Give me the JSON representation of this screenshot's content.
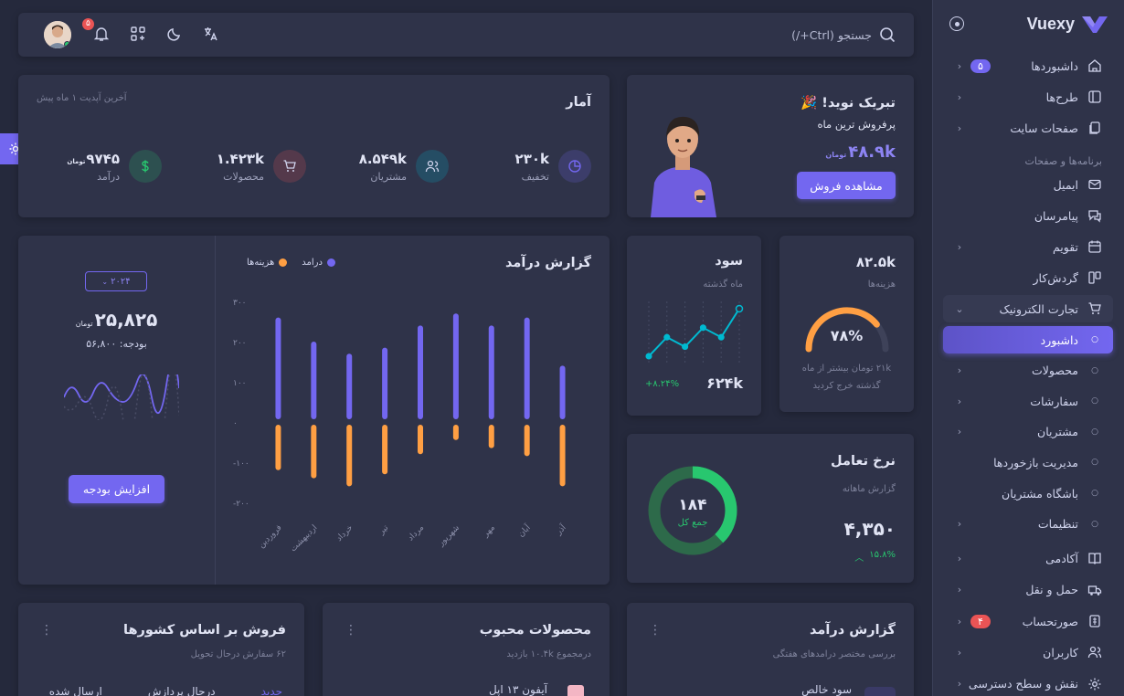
{
  "sidebar": {
    "brand": "Vuexy",
    "brand_color": "#7367f0",
    "items": [
      {
        "label": "داشبوردها",
        "icon": "home-icon",
        "badge": "۵",
        "badge_color": "#7367f0",
        "chev": true
      },
      {
        "label": "طرح‌ها",
        "icon": "layout-icon",
        "chev": true
      },
      {
        "label": "صفحات سایت",
        "icon": "files-icon",
        "chev": true
      }
    ],
    "section_apps": "برنامه‌ها و صفحات",
    "apps": [
      {
        "label": "ایمیل",
        "icon": "mail-icon"
      },
      {
        "label": "پیامرسان",
        "icon": "message-icon"
      },
      {
        "label": "تقویم",
        "icon": "calendar-icon",
        "chev": true
      },
      {
        "label": "گردش‌کار",
        "icon": "kanban-icon"
      },
      {
        "label": "تجارت الکترونیک",
        "icon": "cart-icon",
        "open": true
      }
    ],
    "ecom_sub": [
      {
        "label": "داشبورد",
        "active": true
      },
      {
        "label": "محصولات",
        "chev": true
      },
      {
        "label": "سفارشات",
        "chev": true
      },
      {
        "label": "مشتریان",
        "chev": true
      },
      {
        "label": "مدیریت بازخوردها"
      },
      {
        "label": "باشگاه مشتریان"
      },
      {
        "label": "تنظیمات",
        "chev": true
      }
    ],
    "more": [
      {
        "label": "آکادمی",
        "icon": "book-icon",
        "chev": true
      },
      {
        "label": "حمل و نقل",
        "icon": "truck-icon",
        "chev": true
      },
      {
        "label": "صورتحساب",
        "icon": "invoice-icon",
        "badge": "۴",
        "badge_color": "#ea5455",
        "chev": true
      },
      {
        "label": "کاربران",
        "icon": "users-icon",
        "chev": true
      },
      {
        "label": "نقش و سطح دسترسی",
        "icon": "settings-icon",
        "chev": true
      }
    ]
  },
  "topbar": {
    "search_placeholder": "جستجو (Ctrl+/)",
    "notif_count": "۵"
  },
  "congrats": {
    "title": "تبریک نوید! 🎉",
    "subtitle": "پرفروش ترین ماه",
    "amount": "۴۸.۹k",
    "currency": "تومان",
    "button": "مشاهده فروش"
  },
  "stats": {
    "title": "آمار",
    "updated": "آخرین آپدیت ۱ ماه پیش",
    "items": [
      {
        "value": "۲۳۰k",
        "label": "تخفیف",
        "color": "#7367f0",
        "icon": "pie-icon"
      },
      {
        "value": "۸.۵۴۹k",
        "label": "مشتریان",
        "color": "#00bad1",
        "icon": "users-icon"
      },
      {
        "value": "۱.۴۲۳k",
        "label": "محصولات",
        "color": "#ea5455",
        "icon": "cart-icon"
      },
      {
        "value": "۹۷۴۵",
        "currency": "تومان",
        "label": "درآمد",
        "color": "#28c76f",
        "icon": "dollar-icon"
      }
    ]
  },
  "expenses": {
    "value": "۸۲.۵k",
    "label": "هزینه‌ها",
    "percent": "۷۸%",
    "percent_value": 78,
    "note_line1": "۲۱k تومان بیشتر از ماه",
    "note_line2": "گذشته خرج کردید",
    "color": "#ff9f43"
  },
  "profit": {
    "title": "سود",
    "subtitle": "ماه گذشته",
    "value": "۶۲۴k",
    "change": "+۸.۲۴%",
    "color": "#00bad1",
    "chart_data": {
      "type": "line",
      "x": [
        1,
        2,
        3,
        4,
        5,
        6
      ],
      "values": [
        1,
        3,
        2,
        4,
        3,
        6
      ]
    }
  },
  "revenue_report": {
    "title": "گزارش درآمد",
    "legend": [
      {
        "name": "درامد",
        "color": "#7367f0"
      },
      {
        "name": "هزینه‌ها",
        "color": "#ff9f43"
      }
    ],
    "year_button": "۲۰۲۴",
    "total": "۲۵,۸۲۵",
    "currency": "تومان",
    "budget": "بودجه: ۵۶,۸۰۰",
    "button": "افزایش بودجه",
    "chart_data": {
      "type": "bar",
      "categories": [
        "فروردین",
        "اردیبهشت",
        "خرداد",
        "تیر",
        "مرداد",
        "شهریور",
        "مهر",
        "آبان",
        "آذر"
      ],
      "yticks": [
        "۳۰۰",
        "۲۰۰",
        "۱۰۰",
        "۰",
        "-۱۰۰",
        "-۲۰۰"
      ],
      "ylim": [
        -200,
        300
      ],
      "series": [
        {
          "name": "درامد",
          "values": [
            260,
            200,
            170,
            185,
            240,
            270,
            240,
            260,
            140
          ]
        },
        {
          "name": "هزینه‌ها",
          "values": [
            -120,
            -140,
            -160,
            -130,
            -80,
            -45,
            -65,
            -85,
            -160
          ]
        }
      ]
    }
  },
  "engagement": {
    "title": "نرخ تعامل",
    "subtitle": "گزارش ماهانه",
    "value": "۴,۳۵۰",
    "change": "۱۵.۸%",
    "donut_value": "۱۸۴",
    "donut_label": "جمع کل",
    "color": "#28c76f"
  },
  "bottom": {
    "card1": {
      "title": "گزارش درآمد",
      "subtitle": "بررسی مختصر درامدهای هفتگی",
      "row": "سود خالص"
    },
    "card2": {
      "title": "محصولات محبوب",
      "subtitle": "درمجموع ۱۰.۴k بازدید",
      "row": "آیفون ۱۳ اپل"
    },
    "card3": {
      "title": "فروش بر اساس کشورها",
      "subtitle": "۶۲ سفارش درحال تحویل",
      "tabs": [
        "جدید",
        "درحال پردازش",
        "ارسال شده"
      ]
    }
  }
}
